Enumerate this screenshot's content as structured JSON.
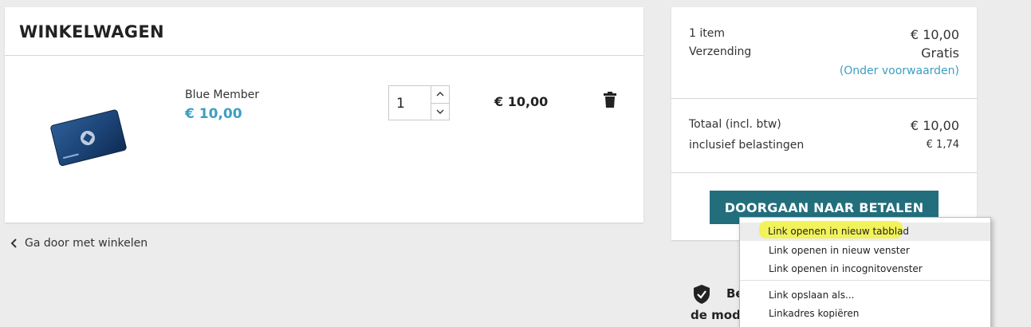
{
  "cart": {
    "title": "WINKELWAGEN",
    "item": {
      "name": "Blue Member",
      "price": "€ 10,00",
      "quantity": "1",
      "line_total": "€ 10,00"
    },
    "continue_label": "Ga door met winkelen"
  },
  "summary": {
    "items_label": "1 item",
    "items_value": "€ 10,00",
    "shipping_label": "Verzending",
    "shipping_value": "Gratis",
    "terms_link": "(Onder voorwaarden)",
    "total_label": "Totaal (incl. btw)",
    "total_value": "€ 10,00",
    "tax_label": "inclusief belastingen",
    "tax_value": "€ 1,74",
    "checkout_label": "DOORGAAN NAAR BETALEN"
  },
  "reassurance": {
    "line1": "Be",
    "line2": "de mod"
  },
  "context_menu": {
    "items": [
      {
        "label": "Link openen in nieuw tabblad"
      },
      {
        "label": "Link openen in nieuw venster"
      },
      {
        "label": "Link openen in incognitovenster"
      },
      {
        "label": "Link opslaan als..."
      },
      {
        "label": "Linkadres kopiëren"
      }
    ]
  },
  "colors": {
    "accent": "#3b9ec2",
    "button": "#226e7c",
    "highlight": "#f3f34a"
  },
  "icons": [
    "card-image",
    "chevron-up-icon",
    "chevron-down-icon",
    "trash-icon",
    "chevron-left-icon",
    "shield-check-icon"
  ]
}
